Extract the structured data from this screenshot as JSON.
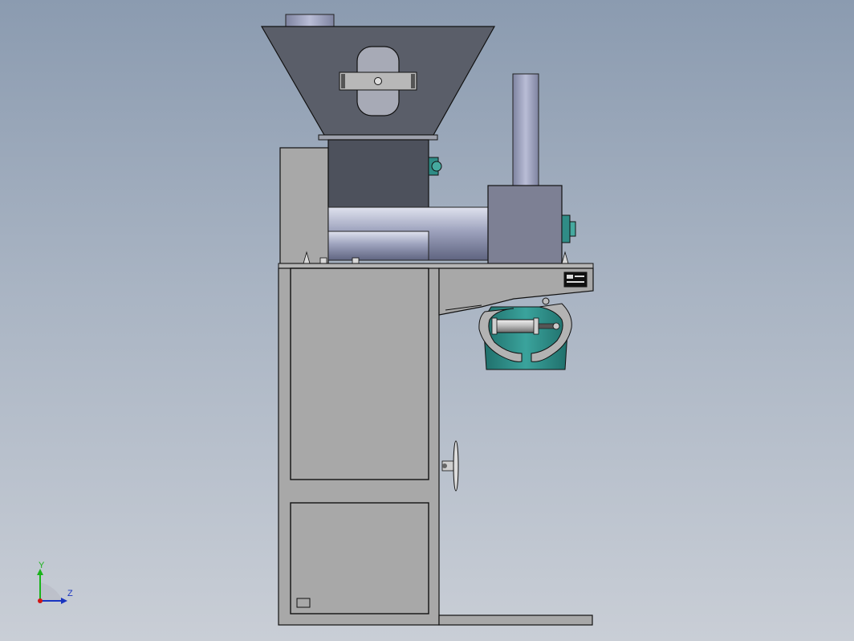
{
  "viewport": {
    "background_top": "#8b9bb0",
    "background_bottom": "#c9ced6"
  },
  "model": {
    "frame_color": "#a8a8a8",
    "hopper_color": "#5a5e69",
    "housing_color": "#7d8094",
    "teal_color": "#2f8c86",
    "components": [
      "hopper",
      "feed-chute",
      "inspection-window",
      "motor-housing-left",
      "auger-tube",
      "exhaust-pipe",
      "gearbox-housing",
      "frame-top-plate",
      "cabinet-door-upper",
      "cabinet-door-lower",
      "bag-clamp-assembly",
      "pneumatic-cylinder",
      "handwheel",
      "base-rail",
      "nameplate"
    ]
  },
  "triad": {
    "y_label": "Y",
    "z_label": "Z",
    "y_color": "#1bb31b",
    "z_color": "#1a35c0",
    "x_color": "#d01515"
  }
}
